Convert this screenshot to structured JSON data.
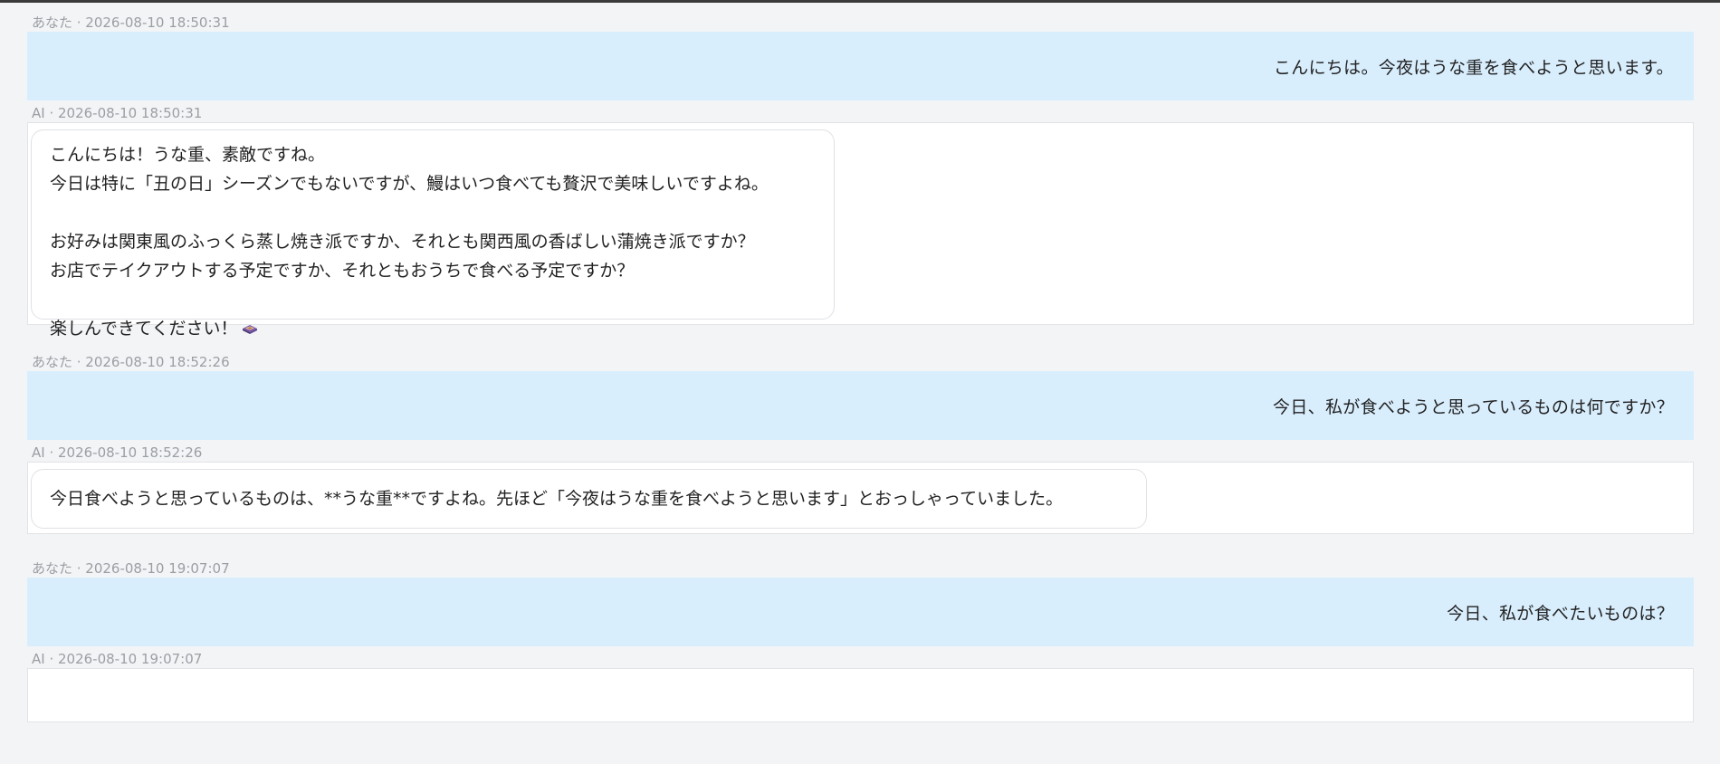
{
  "messages": [
    {
      "role": "user",
      "meta": "あなた · 2026-08-10 18:50:31",
      "text": "こんにちは。今夜はうな重を食べようと思います。"
    },
    {
      "role": "ai",
      "meta": "AI · 2026-08-10 18:50:31",
      "lines": [
        "こんにちは！うな重、素敵ですね。",
        "今日は特に「丑の日」シーズンでもないですが、鰻はいつ食べても贅沢で美味しいですよね。",
        "",
        "お好みは関東風のふっくら蒸し焼き派ですか、それとも関西風の香ばしい蒲焼き派ですか？",
        "お店でテイクアウトする予定ですか、それともおうちで食べる予定ですか？",
        "",
        "楽しんできてください！"
      ],
      "emoji": "bento-box-icon"
    },
    {
      "role": "user",
      "meta": "あなた · 2026-08-10 18:52:26",
      "text": "今日、私が食べようと思っているものは何ですか？"
    },
    {
      "role": "ai",
      "meta": "AI · 2026-08-10 18:52:26",
      "lines": [
        "今日食べようと思っているものは、**うな重**ですよね。先ほど「今夜はうな重を食べようと思います」とおっしゃっていました。"
      ]
    },
    {
      "role": "user",
      "meta": "あなた · 2026-08-10 19:07:07",
      "text": "今日、私が食べたいものは？"
    },
    {
      "role": "ai",
      "meta": "AI · 2026-08-10 19:07:07",
      "lines": []
    }
  ],
  "colors": {
    "page_bg": "#f3f4f6",
    "user_bg": "#d9eefd",
    "ai_bg": "#ffffff",
    "meta_text": "#9b9ea3"
  }
}
